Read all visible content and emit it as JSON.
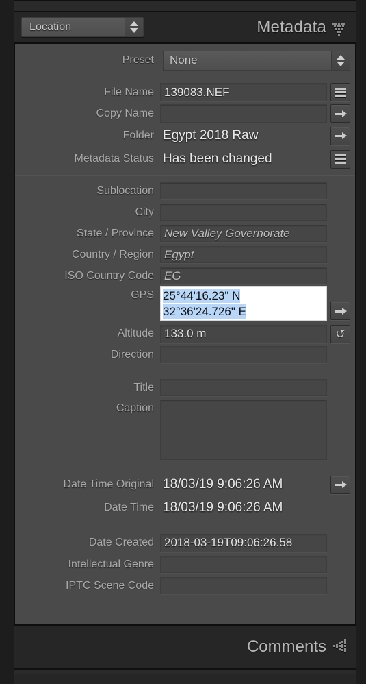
{
  "window": {
    "panel_title": "Metadata",
    "view_selector": {
      "label": "Location",
      "icon": "stepper-updown-icon"
    },
    "collapse_icon": "dotted-triangle-down-icon"
  },
  "preset": {
    "label": "Preset",
    "value": "None",
    "stepper_icon": "stepper-updown-icon"
  },
  "sections": [
    {
      "id": "file-info",
      "rows": [
        {
          "label": "File Name",
          "value": "139083.NEF",
          "style": "box",
          "action": "list-icon"
        },
        {
          "label": "Copy Name",
          "value": "",
          "style": "box",
          "action": "arrow-right-icon"
        },
        {
          "label": "Folder",
          "value": "Egypt 2018 Raw",
          "style": "text",
          "action": "arrow-right-icon"
        },
        {
          "label": "Metadata Status",
          "value": "Has been changed",
          "style": "text",
          "action": "list-icon"
        }
      ]
    },
    {
      "id": "location",
      "rows": [
        {
          "label": "Sublocation",
          "value": "",
          "style": "box",
          "action": "none"
        },
        {
          "label": "City",
          "value": "",
          "style": "box",
          "action": "none"
        },
        {
          "label": "State / Province",
          "value": "New Valley Governorate",
          "style": "italic",
          "action": "none"
        },
        {
          "label": "Country / Region",
          "value": "Egypt",
          "style": "italic",
          "action": "none"
        },
        {
          "label": "ISO Country Code",
          "value": "EG",
          "style": "italic",
          "action": "none"
        }
      ],
      "gps": {
        "label": "GPS",
        "editing": true,
        "line1": "25°44'16.23\" N",
        "line2": "32°36'24.726\" E",
        "selection_color": "#b8d6f8",
        "action": "arrow-right-icon"
      },
      "after_gps": [
        {
          "label": "Altitude",
          "value": "133.0 m",
          "style": "box",
          "action": "sync-icon"
        },
        {
          "label": "Direction",
          "value": "",
          "style": "box",
          "action": "none"
        }
      ]
    },
    {
      "id": "title-caption",
      "rows": [
        {
          "label": "Title",
          "value": "",
          "style": "box",
          "action": "none"
        },
        {
          "label": "Caption",
          "value": "",
          "style": "textarea",
          "action": "none"
        }
      ]
    },
    {
      "id": "datetime",
      "rows": [
        {
          "label": "Date Time Original",
          "value": "18/03/19 9:06:26 AM",
          "style": "text",
          "action": "arrow-right-icon"
        },
        {
          "label": "Date Time",
          "value": "18/03/19 9:06:26 AM",
          "style": "text",
          "action": "none"
        }
      ]
    },
    {
      "id": "iptc",
      "rows": [
        {
          "label": "Date Created",
          "value": "2018-03-19T09:06:26.58",
          "style": "box",
          "action": "none"
        },
        {
          "label": "Intellectual Genre",
          "value": "",
          "style": "box",
          "action": "none"
        },
        {
          "label": "IPTC Scene Code",
          "value": "",
          "style": "box",
          "action": "none"
        }
      ]
    }
  ],
  "comments": {
    "title": "Comments",
    "collapse_icon": "dotted-triangle-left-icon"
  },
  "colors": {
    "panel_bg": "#4a4a4a",
    "chrome_bg": "#262626",
    "field_bg": "#464646",
    "label_text": "#a9a9a9",
    "value_text": "#e8e8e8",
    "selection": "#b8d6f8"
  }
}
